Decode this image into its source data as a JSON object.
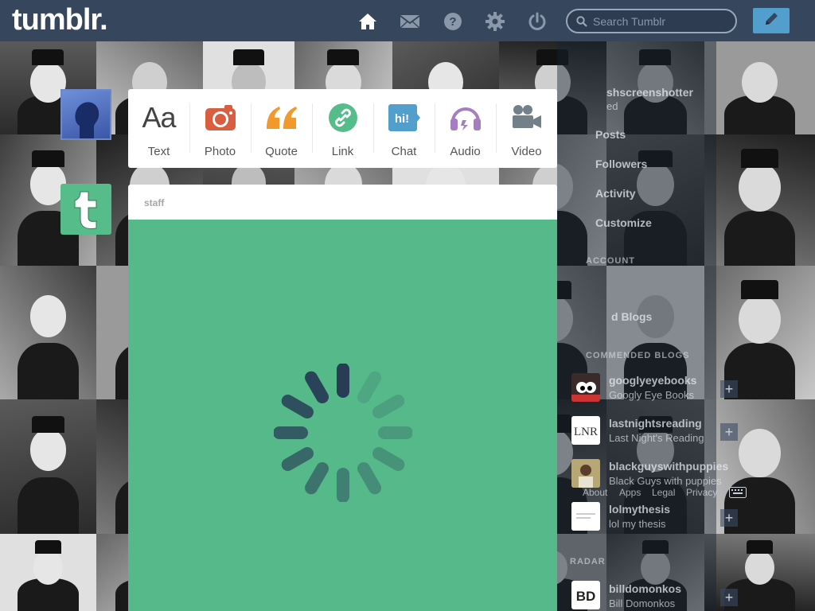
{
  "header": {
    "logo": "tumblr.",
    "nav": [
      {
        "name": "home-icon"
      },
      {
        "name": "mail-icon"
      },
      {
        "name": "help-icon"
      },
      {
        "name": "gear-icon"
      },
      {
        "name": "power-icon"
      }
    ],
    "search_placeholder": "Search Tumblr",
    "compose_icon": "pencil-icon"
  },
  "post_types": [
    {
      "label": "Text",
      "icon": "text-icon",
      "color": "#444444"
    },
    {
      "label": "Photo",
      "icon": "camera-icon",
      "color": "#d95e40"
    },
    {
      "label": "Quote",
      "icon": "quote-icon",
      "color": "#f2992e"
    },
    {
      "label": "Link",
      "icon": "link-icon",
      "color": "#56bc8a"
    },
    {
      "label": "Chat",
      "icon": "chat-icon",
      "color": "#529ecc"
    },
    {
      "label": "Audio",
      "icon": "headphones-icon",
      "color": "#a77dc2"
    },
    {
      "label": "Video",
      "icon": "video-camera-icon",
      "color": "#748089"
    }
  ],
  "post": {
    "author": "staff",
    "body_color": "#55b98a"
  },
  "sidebar": {
    "blog_name": "shscreenshotter",
    "blog_sub": "ed",
    "menu": [
      "Posts",
      "Followers",
      "Activity",
      "Customize"
    ],
    "account_label": "ACCOUNT",
    "liked_label": "d Blogs",
    "recommended_label": "COMMENDED BLOGS",
    "recommended": [
      {
        "name": "googlyeyebooks",
        "sub": "Googly Eye Books"
      },
      {
        "name": "lastnightsreading",
        "sub": "Last Night's Reading"
      },
      {
        "name": "blackguyswithpuppies",
        "sub": "Black Guys with puppies"
      },
      {
        "name": "lolmythesis",
        "sub": "lol my thesis"
      }
    ],
    "footer_links": [
      "About",
      "Apps",
      "Legal",
      "Privacy"
    ],
    "radar_label": "RADAR",
    "radar_blog": {
      "name": "billdomonkos",
      "sub": "Bill Domonkos"
    }
  }
}
